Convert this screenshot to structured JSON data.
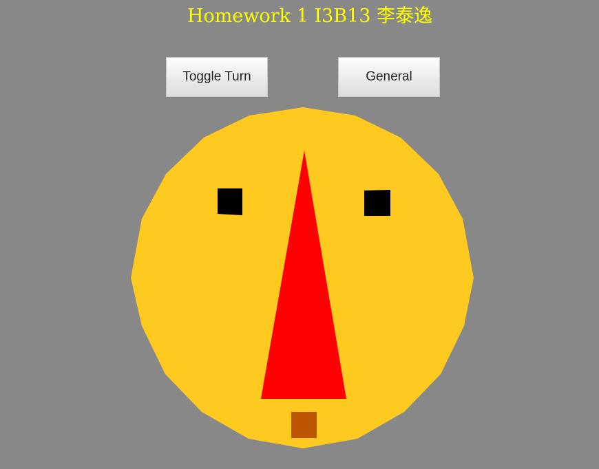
{
  "header": {
    "title": "Homework 1 I3B13 李泰逸"
  },
  "controls": {
    "toggle_turn_label": "Toggle Turn",
    "general_label": "General"
  },
  "colors": {
    "background": "#888888",
    "title": "#ffff00",
    "face": "#ffca20",
    "eyes": "#000000",
    "nose": "#ff0000",
    "mouth": "#bb5500"
  }
}
